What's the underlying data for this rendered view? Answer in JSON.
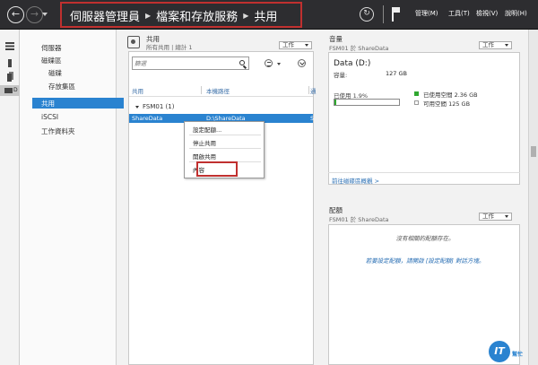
{
  "titlebar": {
    "breadcrumb": [
      "伺服器管理員",
      "檔案和存放服務",
      "共用"
    ],
    "menus": [
      "管理(M)",
      "工具(T)",
      "檢視(V)",
      "說明(H)"
    ]
  },
  "strip": {
    "file_services_label": "D"
  },
  "nav": {
    "items": [
      "伺服器",
      "磁碟區",
      "磁碟",
      "存放集區",
      "共用",
      "iSCSI",
      "工作資料夾"
    ],
    "selected": "共用"
  },
  "shares": {
    "title": "共用",
    "subtitle": "所有共用 | 總計 1",
    "tasks_label": "工作",
    "filter_placeholder": "篩選",
    "columns": [
      "共用",
      "本機路徑",
      "通"
    ],
    "group_label": "FSM01 (1)",
    "rows": [
      {
        "share": "ShareData",
        "path": "D:\\ShareData",
        "proto": "S"
      }
    ]
  },
  "context_menu": {
    "items": [
      "設定配額...",
      "停止共用",
      "開啟共用",
      "內容"
    ],
    "highlighted": "內容"
  },
  "volume": {
    "title": "音量",
    "subtitle": "FSM01 於 ShareData",
    "tasks_label": "工作",
    "name": "Data (D:)",
    "capacity_label": "容量:",
    "capacity_value": "127 GB",
    "used_label": "已使用 1.9%",
    "used_fraction": 0.019,
    "legend_used": "已使用空間 2.36 GB",
    "legend_free": "可用空間 125 GB",
    "used_color": "#30a830",
    "link": "前往磁碟區概觀 >"
  },
  "quota": {
    "title": "配額",
    "subtitle": "FSM01 於 ShareData",
    "tasks_label": "工作",
    "message": "沒有相關的配額存在。",
    "hint": "若要設定配額，請開啟 [設定配額] 對話方塊。"
  },
  "watermark": {
    "logo_text": "IT",
    "logo_sub": "幫忙"
  }
}
